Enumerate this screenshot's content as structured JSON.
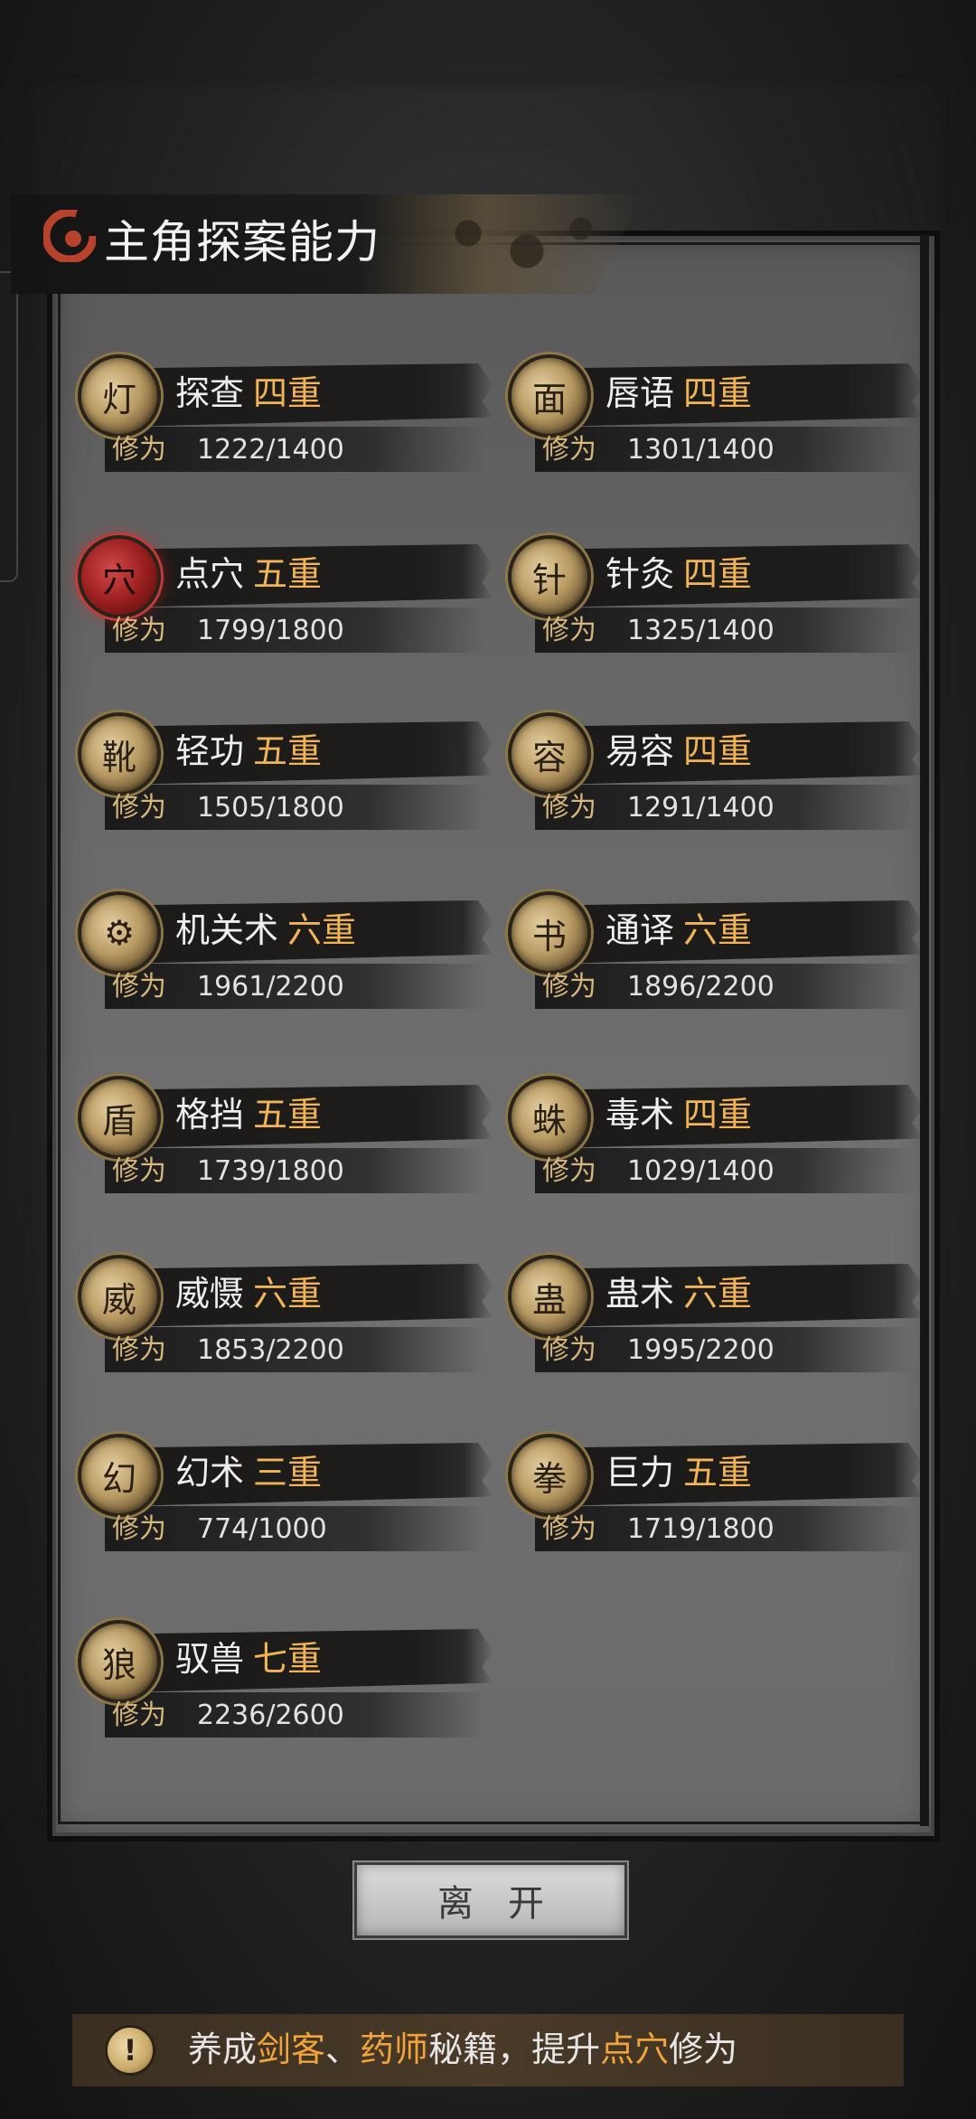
{
  "title": "主角探案能力",
  "skills": [
    {
      "name": "探查",
      "level": "四重",
      "xp_label": "修为",
      "xp": "1222/1400",
      "icon": "lantern-icon"
    },
    {
      "name": "唇语",
      "level": "四重",
      "xp_label": "修为",
      "xp": "1301/1400",
      "icon": "face-icon"
    },
    {
      "name": "点穴",
      "level": "五重",
      "xp_label": "修为",
      "xp": "1799/1800",
      "icon": "acupoint-icon",
      "highlight": true
    },
    {
      "name": "针灸",
      "level": "四重",
      "xp_label": "修为",
      "xp": "1325/1400",
      "icon": "needle-icon"
    },
    {
      "name": "轻功",
      "level": "五重",
      "xp_label": "修为",
      "xp": "1505/1800",
      "icon": "boot-icon"
    },
    {
      "name": "易容",
      "level": "四重",
      "xp_label": "修为",
      "xp": "1291/1400",
      "icon": "mask-icon"
    },
    {
      "name": "机关术",
      "level": "六重",
      "xp_label": "修为",
      "xp": "1961/2200",
      "icon": "gear-icon"
    },
    {
      "name": "通译",
      "level": "六重",
      "xp_label": "修为",
      "xp": "1896/2200",
      "icon": "book-icon"
    },
    {
      "name": "格挡",
      "level": "五重",
      "xp_label": "修为",
      "xp": "1739/1800",
      "icon": "shield-icon"
    },
    {
      "name": "毒术",
      "level": "四重",
      "xp_label": "修为",
      "xp": "1029/1400",
      "icon": "spider-icon"
    },
    {
      "name": "威慑",
      "level": "六重",
      "xp_label": "修为",
      "xp": "1853/2200",
      "icon": "warrior-icon"
    },
    {
      "name": "蛊术",
      "level": "六重",
      "xp_label": "修为",
      "xp": "1995/2200",
      "icon": "worm-icon"
    },
    {
      "name": "幻术",
      "level": "三重",
      "xp_label": "修为",
      "xp": "774/1000",
      "icon": "hooded-figure-icon"
    },
    {
      "name": "巨力",
      "level": "五重",
      "xp_label": "修为",
      "xp": "1719/1800",
      "icon": "fist-icon"
    },
    {
      "name": "驭兽",
      "level": "七重",
      "xp_label": "修为",
      "xp": "2236/2600",
      "icon": "wolf-icon"
    }
  ],
  "leave_button": "离开",
  "tip": {
    "prefix": "养成",
    "hl1": "剑客",
    "sep": "、",
    "hl2": "药师",
    "mid": "秘籍，提升",
    "hl3": "点穴",
    "suffix": "修为"
  },
  "icon_glyphs": {
    "lantern-icon": "灯",
    "face-icon": "面",
    "acupoint-icon": "穴",
    "needle-icon": "针",
    "boot-icon": "靴",
    "mask-icon": "容",
    "gear-icon": "⚙",
    "book-icon": "书",
    "shield-icon": "盾",
    "spider-icon": "蛛",
    "warrior-icon": "威",
    "worm-icon": "蛊",
    "hooded-figure-icon": "幻",
    "fist-icon": "拳",
    "wolf-icon": "狼",
    "tip-icon": "!"
  },
  "colors": {
    "level": "#f3b456",
    "tip_highlight": "#f1a43a",
    "accent_red": "#c23a3a"
  }
}
